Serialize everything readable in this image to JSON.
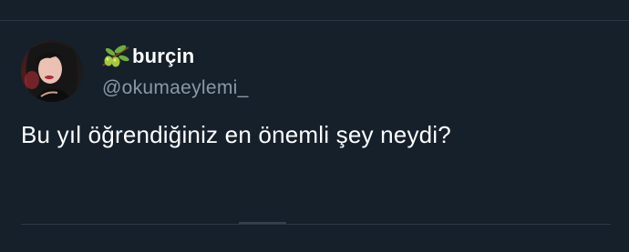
{
  "tweet": {
    "author": {
      "display_name": "burçin",
      "handle": "@okumaeylemi_",
      "name_emoji": "olive-branch-icon"
    },
    "text": "Bu yıl öğrendiğiniz en önemli şey neydi?"
  },
  "colors": {
    "background": "#15202b",
    "divider": "#2a3846",
    "primary_text": "#ffffff",
    "secondary_text": "#8b98a5"
  }
}
